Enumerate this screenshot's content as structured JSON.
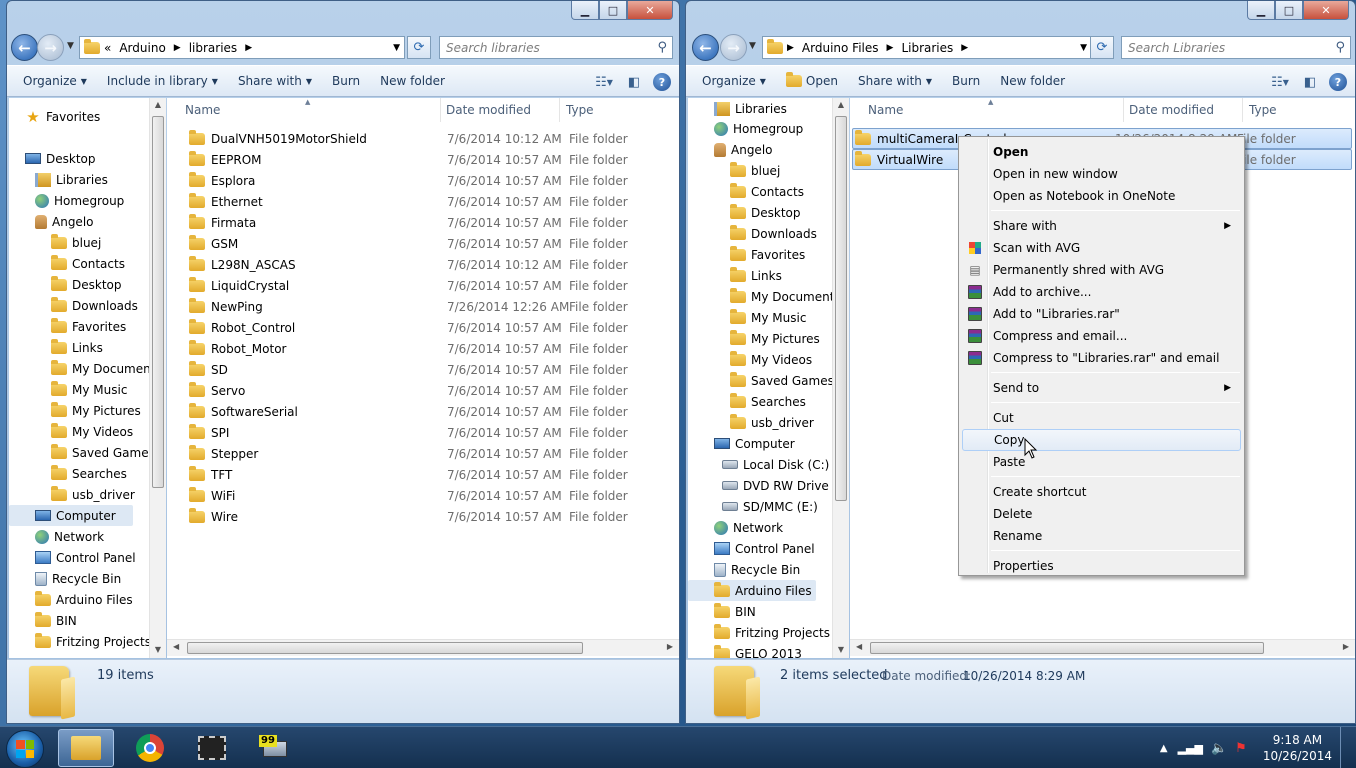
{
  "left_window": {
    "address": {
      "sep_prefix": "«",
      "segments": [
        "Arduino",
        "libraries"
      ]
    },
    "search_placeholder": "Search libraries",
    "toolbar": {
      "organize": "Organize",
      "include": "Include in library",
      "share": "Share with",
      "burn": "Burn",
      "new_folder": "New folder"
    },
    "nav_items": [
      {
        "label": "Favorites",
        "icon": "star-icon"
      },
      {
        "label": "Desktop",
        "icon": "desktop-icon"
      },
      {
        "label": "Libraries",
        "icon": "libraries-icon"
      },
      {
        "label": "Homegroup",
        "icon": "homegroup-icon"
      },
      {
        "label": "Angelo",
        "icon": "user-folder-icon"
      },
      {
        "label": "bluej",
        "icon": "folder-icon"
      },
      {
        "label": "Contacts",
        "icon": "contacts-icon"
      },
      {
        "label": "Desktop",
        "icon": "desktop-folder-icon"
      },
      {
        "label": "Downloads",
        "icon": "downloads-icon"
      },
      {
        "label": "Favorites",
        "icon": "favorites-folder-icon"
      },
      {
        "label": "Links",
        "icon": "links-icon"
      },
      {
        "label": "My Documents",
        "icon": "documents-icon"
      },
      {
        "label": "My Music",
        "icon": "music-icon"
      },
      {
        "label": "My Pictures",
        "icon": "pictures-icon"
      },
      {
        "label": "My Videos",
        "icon": "videos-icon"
      },
      {
        "label": "Saved Games",
        "icon": "saved-games-icon"
      },
      {
        "label": "Searches",
        "icon": "searches-icon"
      },
      {
        "label": "usb_driver",
        "icon": "folder-icon"
      },
      {
        "label": "Computer",
        "icon": "computer-icon"
      },
      {
        "label": "Network",
        "icon": "network-icon"
      },
      {
        "label": "Control Panel",
        "icon": "control-panel-icon"
      },
      {
        "label": "Recycle Bin",
        "icon": "recycle-bin-icon"
      },
      {
        "label": "Arduino Files",
        "icon": "folder-icon"
      },
      {
        "label": "BIN",
        "icon": "folder-icon"
      },
      {
        "label": "Fritzing Projects",
        "icon": "folder-icon"
      }
    ],
    "columns": {
      "name": "Name",
      "date": "Date modified",
      "type": "Type"
    },
    "files": [
      {
        "name": "DualVNH5019MotorShield",
        "date": "7/6/2014 10:12 AM",
        "type": "File folder"
      },
      {
        "name": "EEPROM",
        "date": "7/6/2014 10:57 AM",
        "type": "File folder"
      },
      {
        "name": "Esplora",
        "date": "7/6/2014 10:57 AM",
        "type": "File folder"
      },
      {
        "name": "Ethernet",
        "date": "7/6/2014 10:57 AM",
        "type": "File folder"
      },
      {
        "name": "Firmata",
        "date": "7/6/2014 10:57 AM",
        "type": "File folder"
      },
      {
        "name": "GSM",
        "date": "7/6/2014 10:57 AM",
        "type": "File folder"
      },
      {
        "name": "L298N_ASCAS",
        "date": "7/6/2014 10:12 AM",
        "type": "File folder"
      },
      {
        "name": "LiquidCrystal",
        "date": "7/6/2014 10:57 AM",
        "type": "File folder"
      },
      {
        "name": "NewPing",
        "date": "7/26/2014 12:26 AM",
        "type": "File folder"
      },
      {
        "name": "Robot_Control",
        "date": "7/6/2014 10:57 AM",
        "type": "File folder"
      },
      {
        "name": "Robot_Motor",
        "date": "7/6/2014 10:57 AM",
        "type": "File folder"
      },
      {
        "name": "SD",
        "date": "7/6/2014 10:57 AM",
        "type": "File folder"
      },
      {
        "name": "Servo",
        "date": "7/6/2014 10:57 AM",
        "type": "File folder"
      },
      {
        "name": "SoftwareSerial",
        "date": "7/6/2014 10:57 AM",
        "type": "File folder"
      },
      {
        "name": "SPI",
        "date": "7/6/2014 10:57 AM",
        "type": "File folder"
      },
      {
        "name": "Stepper",
        "date": "7/6/2014 10:57 AM",
        "type": "File folder"
      },
      {
        "name": "TFT",
        "date": "7/6/2014 10:57 AM",
        "type": "File folder"
      },
      {
        "name": "WiFi",
        "date": "7/6/2014 10:57 AM",
        "type": "File folder"
      },
      {
        "name": "Wire",
        "date": "7/6/2014 10:57 AM",
        "type": "File folder"
      }
    ],
    "status": "19 items"
  },
  "right_window": {
    "address": {
      "segments": [
        "Arduino Files",
        "Libraries"
      ]
    },
    "search_placeholder": "Search Libraries",
    "toolbar": {
      "organize": "Organize",
      "open": "Open",
      "share": "Share with",
      "burn": "Burn",
      "new_folder": "New folder"
    },
    "nav_items": [
      {
        "label": "Libraries",
        "icon": "libraries-icon"
      },
      {
        "label": "Homegroup",
        "icon": "homegroup-icon"
      },
      {
        "label": "Angelo",
        "icon": "user-folder-icon"
      },
      {
        "label": "bluej",
        "icon": "folder-icon"
      },
      {
        "label": "Contacts",
        "icon": "contacts-icon"
      },
      {
        "label": "Desktop",
        "icon": "desktop-folder-icon"
      },
      {
        "label": "Downloads",
        "icon": "downloads-icon"
      },
      {
        "label": "Favorites",
        "icon": "favorites-folder-icon"
      },
      {
        "label": "Links",
        "icon": "links-icon"
      },
      {
        "label": "My Documents",
        "icon": "documents-icon"
      },
      {
        "label": "My Music",
        "icon": "music-icon"
      },
      {
        "label": "My Pictures",
        "icon": "pictures-icon"
      },
      {
        "label": "My Videos",
        "icon": "videos-icon"
      },
      {
        "label": "Saved Games",
        "icon": "saved-games-icon"
      },
      {
        "label": "Searches",
        "icon": "searches-icon"
      },
      {
        "label": "usb_driver",
        "icon": "folder-icon"
      },
      {
        "label": "Computer",
        "icon": "computer-icon"
      },
      {
        "label": "Local Disk (C:)",
        "icon": "local-disk-icon"
      },
      {
        "label": "DVD RW Drive (",
        "icon": "dvd-drive-icon"
      },
      {
        "label": "SD/MMC (E:)",
        "icon": "sd-card-icon"
      },
      {
        "label": "Network",
        "icon": "network-icon"
      },
      {
        "label": "Control Panel",
        "icon": "control-panel-icon"
      },
      {
        "label": "Recycle Bin",
        "icon": "recycle-bin-icon"
      },
      {
        "label": "Arduino Files",
        "icon": "folder-icon"
      },
      {
        "label": "BIN",
        "icon": "folder-icon"
      },
      {
        "label": "Fritzing Projects",
        "icon": "folder-icon"
      },
      {
        "label": "GELO 2013",
        "icon": "star-folder-icon"
      }
    ],
    "columns": {
      "name": "Name",
      "date": "Date modified",
      "type": "Type"
    },
    "files": [
      {
        "name": "multiCameraIrControl",
        "date": "10/26/2014 8:29 AM",
        "type": "File folder"
      },
      {
        "name": "VirtualWire",
        "date": "",
        "type": "File folder"
      }
    ],
    "status": {
      "selected": "2 items selected",
      "date_label": "Date modified:",
      "date_value": "10/26/2014 8:29 AM"
    }
  },
  "context_menu": [
    {
      "label": "Open",
      "bold": true
    },
    {
      "label": "Open in new window"
    },
    {
      "label": "Open as Notebook in OneNote"
    },
    {
      "sep": true
    },
    {
      "label": "Share with",
      "submenu": true
    },
    {
      "label": "Scan with AVG",
      "icon": "avg-icon"
    },
    {
      "label": "Permanently shred with AVG",
      "icon": "shred-icon"
    },
    {
      "label": "Add to archive...",
      "icon": "winrar-icon"
    },
    {
      "label": "Add to \"Libraries.rar\"",
      "icon": "winrar-icon"
    },
    {
      "label": "Compress and email...",
      "icon": "winrar-icon"
    },
    {
      "label": "Compress to \"Libraries.rar\" and email",
      "icon": "winrar-icon"
    },
    {
      "sep": true
    },
    {
      "label": "Send to",
      "submenu": true
    },
    {
      "sep": true
    },
    {
      "label": "Cut"
    },
    {
      "label": "Copy",
      "hover": true
    },
    {
      "label": "Paste"
    },
    {
      "sep": true
    },
    {
      "label": "Create shortcut"
    },
    {
      "label": "Delete"
    },
    {
      "label": "Rename"
    },
    {
      "sep": true
    },
    {
      "label": "Properties"
    }
  ],
  "taskbar": {
    "time": "9:18 AM",
    "date": "10/26/2014",
    "monitor_badge": "99"
  }
}
